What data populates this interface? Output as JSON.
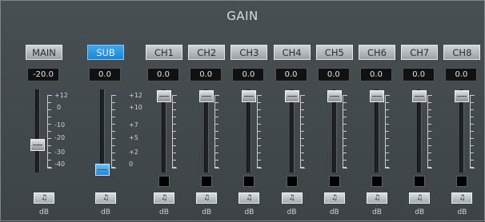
{
  "title": "GAIN",
  "main": {
    "label": "MAIN",
    "value": "-20.0",
    "scale": [
      "+12",
      "0",
      "-10",
      "-20",
      "-30",
      "-40"
    ],
    "fader_level": 0.34,
    "mute_icon": "speaker-icon",
    "unit": "dB"
  },
  "sub": {
    "label": "SUB",
    "value": "0.0",
    "scale_left": [
      "+12",
      "+10",
      "+7",
      "+5",
      "+2",
      "0"
    ],
    "fader_level": 0.0,
    "mute_icon": "speaker-icon",
    "unit": "dB"
  },
  "channels": [
    {
      "label": "CH1",
      "value": "0.0",
      "unit": "dB",
      "fader_level": 1.0
    },
    {
      "label": "CH2",
      "value": "0.0",
      "unit": "dB",
      "fader_level": 1.0
    },
    {
      "label": "CH3",
      "value": "0.0",
      "unit": "dB",
      "fader_level": 1.0
    },
    {
      "label": "CH4",
      "value": "0.0",
      "unit": "dB",
      "fader_level": 1.0
    },
    {
      "label": "CH5",
      "value": "0.0",
      "unit": "dB",
      "fader_level": 1.0
    },
    {
      "label": "CH6",
      "value": "0.0",
      "unit": "dB",
      "fader_level": 1.0
    },
    {
      "label": "CH7",
      "value": "0.0",
      "unit": "dB",
      "fader_level": 1.0
    },
    {
      "label": "CH8",
      "value": "0.0",
      "unit": "dB",
      "fader_level": 1.0
    }
  ],
  "colors": {
    "active": "#1c86d6",
    "panel": "#444b4f"
  }
}
